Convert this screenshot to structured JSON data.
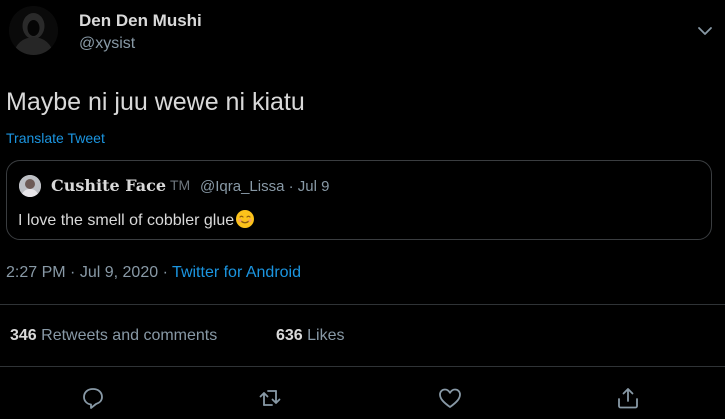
{
  "author": {
    "display_name": "Den Den Mushi",
    "handle": "@xysist"
  },
  "tweet": {
    "text": "Maybe ni juu wewe ni kiatu",
    "translate_label": "Translate Tweet"
  },
  "quoted_tweet": {
    "display_name": "Cushite Face",
    "name_suffix": "TM",
    "handle": "@Iqra_Lissa",
    "separator": "·",
    "date": "Jul 9",
    "text": "I love the smell of cobbler glue",
    "emoji": "smiling-face-emoji"
  },
  "meta": {
    "time": "2:27 PM",
    "date": "Jul 9, 2020",
    "separator": "·",
    "source": "Twitter for Android"
  },
  "stats": {
    "retweets_count": "346",
    "retweets_label": "Retweets and comments",
    "likes_count": "636",
    "likes_label": "Likes"
  },
  "actions": {
    "reply_icon": "reply-icon",
    "retweet_icon": "retweet-icon",
    "like_icon": "heart-icon",
    "share_icon": "share-icon"
  },
  "colors": {
    "background": "#000000",
    "text": "#d9d9d9",
    "secondary": "#8899a6",
    "link": "#1b95e0",
    "border": "#2f3336"
  }
}
